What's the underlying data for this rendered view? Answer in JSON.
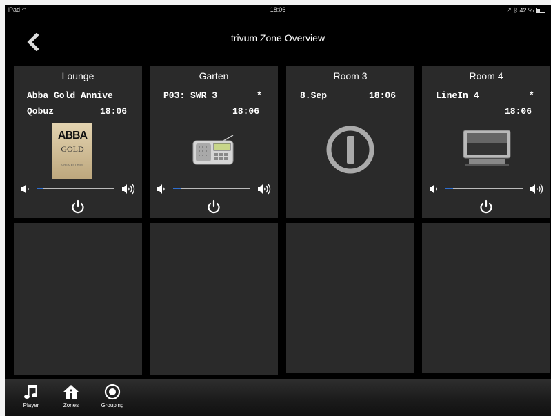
{
  "status": {
    "device": "iPad",
    "time": "18:06",
    "battery": "42 %"
  },
  "nav": {
    "title": "trivum Zone Overview"
  },
  "zones": [
    {
      "name": "Lounge",
      "line1": "Abba Gold Annive",
      "line2a": "Qobuz",
      "line2b": "18:06",
      "album_title": "ABBA",
      "album_sub": "GOLD",
      "album_tag": "GREATEST HITS",
      "volume_fraction": 0.08
    },
    {
      "name": "Garten",
      "line1a": "P03: SWR 3",
      "line1b": "*",
      "line2": "18:06",
      "volume_fraction": 0.1
    },
    {
      "name": "Room 3",
      "line1a": "8.Sep",
      "line1b": "18:06"
    },
    {
      "name": "Room 4",
      "line1a": "LineIn 4",
      "line1b": "*",
      "line2": "18:06",
      "volume_fraction": 0.1
    }
  ],
  "tabs": [
    {
      "label": "Player"
    },
    {
      "label": "Zones"
    },
    {
      "label": "Grouping"
    }
  ],
  "colors": {
    "accent": "#2f6fd0",
    "tile": "#2a2a2a",
    "background": "#000000"
  }
}
